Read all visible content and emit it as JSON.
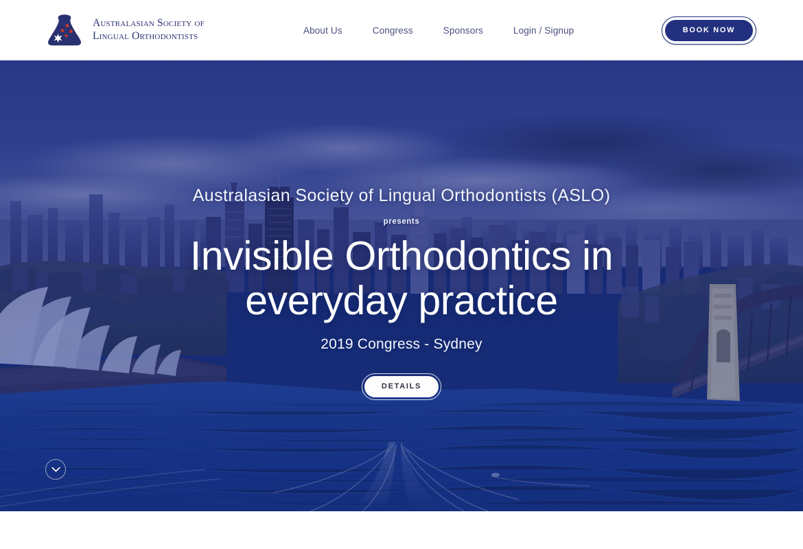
{
  "header": {
    "brand": {
      "logo_icon": "tooth-southern-cross-icon",
      "line1": "Australasian Society of",
      "line2": "Lingual Orthodontists",
      "logo_color": "#2a3170",
      "star_color": "#c0392b"
    },
    "nav": [
      {
        "label": "About Us",
        "name": "nav-about-us"
      },
      {
        "label": "Congress",
        "name": "nav-congress"
      },
      {
        "label": "Sponsors",
        "name": "nav-sponsors"
      },
      {
        "label": "Login / Signup",
        "name": "nav-login-signup"
      }
    ],
    "cta": {
      "label": "BOOK NOW",
      "color": "#22307f"
    }
  },
  "hero": {
    "eyebrow": "Australasian Society of Lingual Orthodontists (ASLO)",
    "presents": "presents",
    "title": "Invisible Orthodontics in everyday practice",
    "subtitle": "2019 Congress - Sydney",
    "cta": {
      "label": "DETAILS"
    },
    "scroll_icon": "chevron-down-icon",
    "background": {
      "description": "Aerial photograph of Sydney Harbour with city skyline, Opera House and Harbour Bridge",
      "overlay_color": "#2e3a8c"
    }
  }
}
